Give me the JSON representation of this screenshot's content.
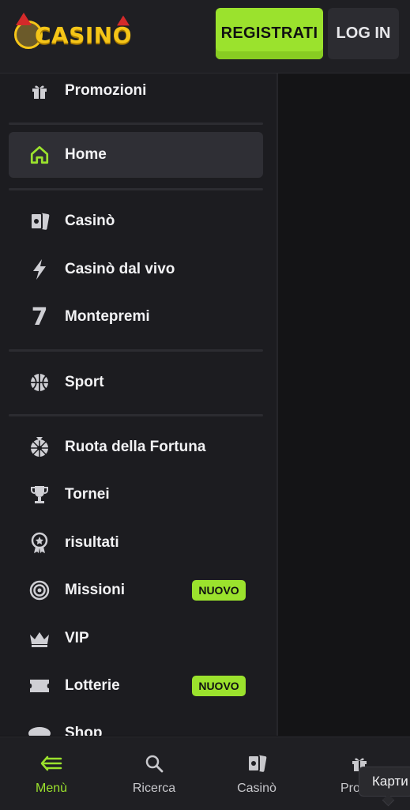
{
  "header": {
    "logo_text": "CASINO",
    "register_label": "REGISTRATI",
    "login_label": "LOG IN"
  },
  "sidebar": {
    "items": [
      {
        "label": "Promozioni",
        "icon": "gift-icon"
      },
      {
        "label": "Home",
        "icon": "home-icon",
        "active": true
      },
      {
        "label": "Casinò",
        "icon": "cards-icon"
      },
      {
        "label": "Casinò dal vivo",
        "icon": "lightning-icon"
      },
      {
        "label": "Montepremi",
        "icon": "seven-icon"
      },
      {
        "label": "Sport",
        "icon": "basketball-icon"
      },
      {
        "label": "Ruota della Fortuna",
        "icon": "wheel-icon"
      },
      {
        "label": "Tornei",
        "icon": "trophy-icon"
      },
      {
        "label": "risultati",
        "icon": "medal-icon"
      },
      {
        "label": "Missioni",
        "icon": "target-icon",
        "badge": "NUOVO"
      },
      {
        "label": "VIP",
        "icon": "crown-icon"
      },
      {
        "label": "Lotterie",
        "icon": "ticket-icon",
        "badge": "NUOVO"
      },
      {
        "label": "Shop",
        "icon": "shop-icon"
      }
    ]
  },
  "bottom_nav": {
    "items": [
      {
        "label": "Menù",
        "icon": "menu-back-icon",
        "active": true
      },
      {
        "label": "Ricerca",
        "icon": "search-icon"
      },
      {
        "label": "Casinò",
        "icon": "cards-icon"
      },
      {
        "label": "Pro",
        "icon": "gift-icon"
      }
    ]
  },
  "tooltip": {
    "text": "Карти"
  },
  "colors": {
    "accent": "#9be22d",
    "background": "#141416",
    "sidebar": "#1c1c20"
  }
}
